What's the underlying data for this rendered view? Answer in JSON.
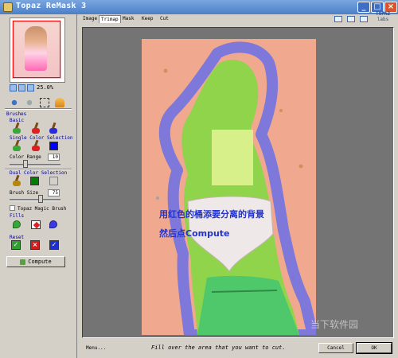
{
  "window": {
    "title": "Topaz ReMask 3"
  },
  "navigator": {
    "zoom": "25.0%"
  },
  "left_panel": {
    "brushes_label": "Brushes",
    "basic_label": "Basic",
    "single_color_label": "Single Color Selection",
    "color_range_label": "Color Range",
    "color_range_value": "10",
    "color_range_level": 0.3,
    "dual_color_label": "Dual Color Selection",
    "brush_size_label": "Brush Size",
    "brush_size_value": "75",
    "brush_size_level": 0.62,
    "magic_brush_label": "Topaz Magic Brush",
    "fills_label": "Fills",
    "reset_label": "Reset",
    "compute_label": "Compute",
    "colors": {
      "single_swatch": "#0000ff",
      "dual_swatch_a": "#008000",
      "dual_swatch_b": "#d4d0c8"
    }
  },
  "tabs": [
    {
      "label": "Image"
    },
    {
      "label": "Trimap"
    },
    {
      "label": "Mask"
    },
    {
      "label": "Keep"
    },
    {
      "label": "Cut"
    }
  ],
  "logo": {
    "line1": "TOPAZ",
    "line2": "labs"
  },
  "overlay_text": {
    "line1": "用红色的桶添要分离的背景",
    "line2": "然后点Compute"
  },
  "watermark": "当下软件园",
  "statusbar": {
    "menu_label": "Menu...",
    "status_text": "Fill over the area that you want to cut.",
    "cancel_label": "Cancel",
    "ok_label": "OK"
  }
}
